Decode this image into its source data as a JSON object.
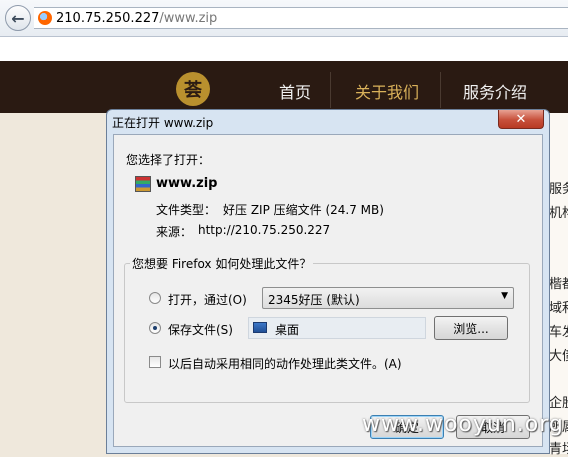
{
  "browser": {
    "url_host": "210.75.250.227",
    "url_path": "/www.zip"
  },
  "site": {
    "logo_glyph": "荟",
    "nav": [
      {
        "label": "首页",
        "active": false
      },
      {
        "label": "关于我们",
        "active": true
      },
      {
        "label": "服务介绍",
        "active": false
      }
    ],
    "right_snippets": [
      "服务",
      "机构",
      "楷都",
      "域和",
      "车发",
      "大债",
      "企股",
      "所属",
      "青场"
    ]
  },
  "dialog": {
    "title": "正在打开 www.zip",
    "close_label": "✕",
    "intro": "您选择了打开：",
    "file_name": "www.zip",
    "file_type_label": "文件类型：",
    "file_type_value": "好压 ZIP 压缩文件 (24.7 MB)",
    "source_label": "来源：",
    "source_value": "http://210.75.250.227",
    "group_title": "您想要 Firefox 如何处理此文件？",
    "open_with_label": "打开，通过(O)",
    "open_with_value": "2345好压 (默认)",
    "save_file_label": "保存文件(S)",
    "save_folder": "桌面",
    "browse_label": "浏览...",
    "auto_label": "以后自动采用相同的动作处理此类文件。(A)",
    "ok_label": "确定",
    "cancel_label": "取消",
    "selected_option": "save"
  },
  "watermark": "www.wooyun.org"
}
